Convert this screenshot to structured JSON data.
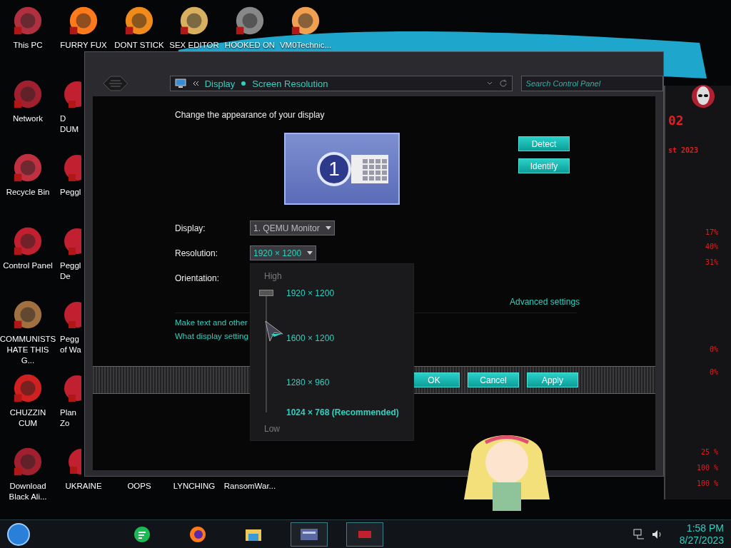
{
  "desktop_icons": [
    {
      "label": "This PC"
    },
    {
      "label": "FURRY FUX"
    },
    {
      "label": "DONT STICK"
    },
    {
      "label": "SEX EDITOR"
    },
    {
      "label": "HOOKED ON"
    },
    {
      "label": "VM0Technic..."
    },
    {
      "label": "Network"
    },
    {
      "label": "Recycle Bin"
    },
    {
      "label": "Control Panel"
    },
    {
      "label": "COMMUNISTS HATE THIS G..."
    },
    {
      "label": "CHUZZIN CUM"
    },
    {
      "label": "Download Black Ali..."
    },
    {
      "label": "UKRAINE"
    },
    {
      "label": "OOPS"
    },
    {
      "label": "LYNCHING"
    },
    {
      "label": "RansomWar..."
    }
  ],
  "partial_icons": [
    {
      "label": "D\nDUM"
    },
    {
      "label": "Peggl"
    },
    {
      "label": "Peggl\nDe"
    },
    {
      "label": "Pegg\nof Wa"
    },
    {
      "label": "Plan\nZo"
    }
  ],
  "window": {
    "breadcrumb": [
      {
        "label": "Display"
      },
      {
        "label": "Screen Resolution"
      }
    ],
    "search": {
      "placeholder": "Search Control Panel"
    },
    "heading": "Change the appearance of your display",
    "monitor": {
      "number": "1"
    },
    "side_buttons": [
      "Detect",
      "Identify"
    ],
    "fields": [
      {
        "label": "Display:",
        "value": "1. QEMU Monitor",
        "focused": false
      },
      {
        "label": "Resolution:",
        "value": "1920 × 1200",
        "focused": true
      },
      {
        "label": "Orientation:"
      }
    ],
    "advanced_link": "Advanced settings",
    "links": [
      "Make text and other",
      "What display setting"
    ],
    "buttons": [
      "OK",
      "Cancel",
      "Apply"
    ]
  },
  "resolution_popup": {
    "high_label": "High",
    "low_label": "Low",
    "slider": {
      "level": 1
    },
    "options": [
      {
        "label": "1920 × 1200",
        "recommended": false
      },
      {
        "label": "1600 × 1200",
        "recommended": false
      },
      {
        "label": "1280 × 960",
        "recommended": false
      },
      {
        "label": "1024 × 768 (Recommended)",
        "recommended": true
      }
    ]
  },
  "gadget": {
    "header": [
      "02",
      "st 2023"
    ],
    "readings": [
      "17%",
      "40%",
      "31%",
      "0%",
      "0%",
      "25 %",
      "100 %",
      "100 %"
    ]
  },
  "taskbar": {
    "apps": [
      {
        "running": false
      },
      {
        "running": false
      },
      {
        "running": false
      },
      {
        "running": true
      },
      {
        "running": true
      }
    ],
    "clock": {
      "time": "1:58 PM",
      "date": "8/27/2023"
    }
  }
}
